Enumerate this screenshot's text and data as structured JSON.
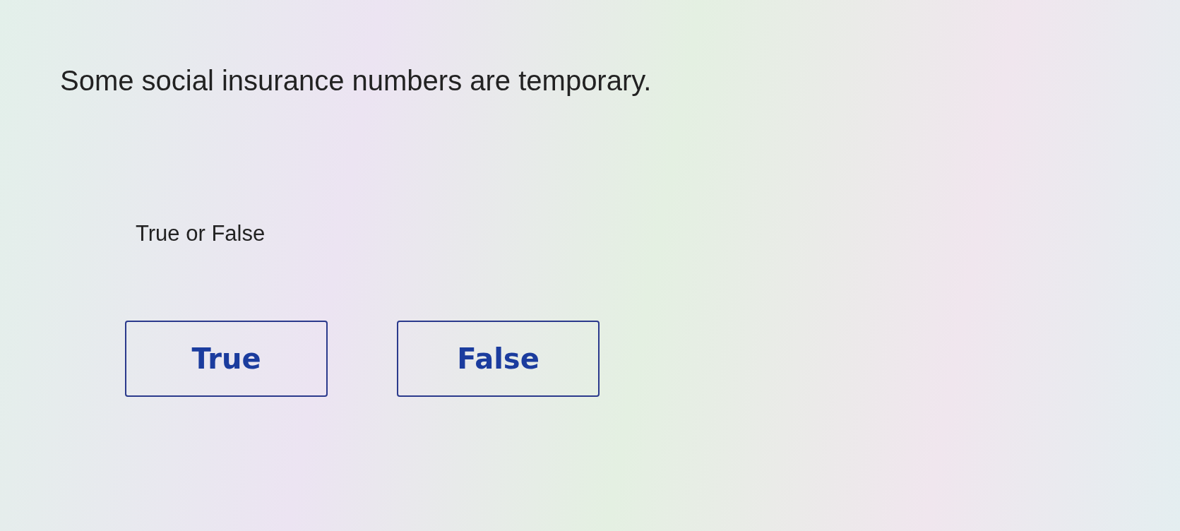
{
  "question": {
    "text": "Some social insurance numbers are temporary."
  },
  "prompt": "True or False",
  "options": [
    {
      "label": "True",
      "selected": false
    },
    {
      "label": "False",
      "selected": false
    }
  ]
}
